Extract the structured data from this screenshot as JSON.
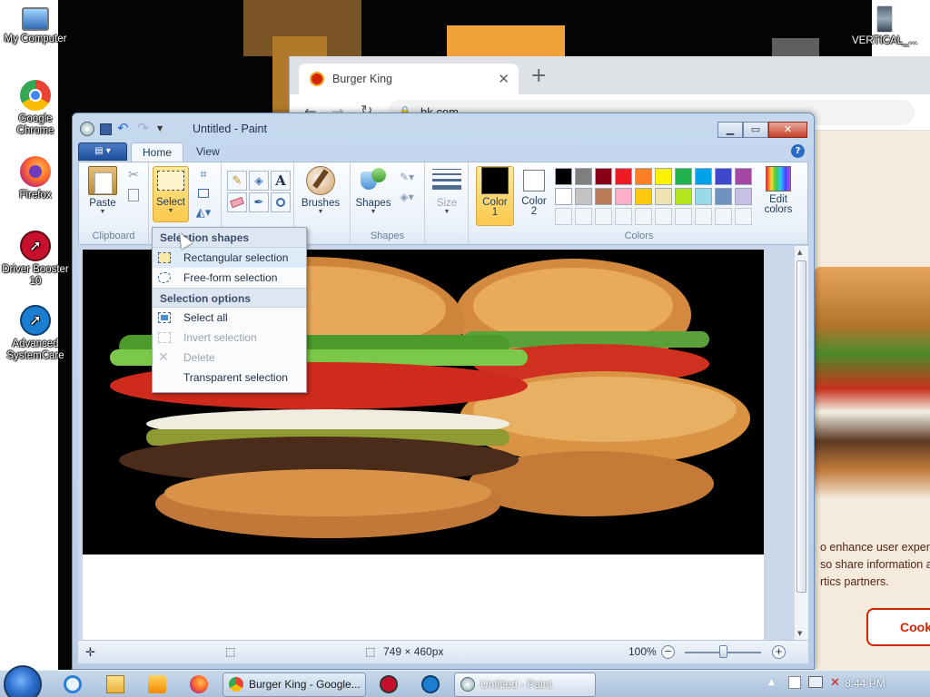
{
  "desktop": {
    "icons": [
      {
        "label_1": "My Computer",
        "label_2": ""
      },
      {
        "label_1": "Google",
        "label_2": "Chrome"
      },
      {
        "label_1": "Firefox",
        "label_2": ""
      },
      {
        "label_1": "Driver Booster",
        "label_2": "10"
      },
      {
        "label_1": "Advanced",
        "label_2": "SystemCare"
      },
      {
        "label_1": "VERTICAL_...",
        "label_2": ""
      }
    ]
  },
  "browser": {
    "tab_title": "Burger King",
    "url": "bk.com",
    "cookie_lines": [
      "o enhance user experie",
      "so share information al",
      "rtics partners."
    ],
    "cookie_button": "Cook"
  },
  "paint": {
    "window_title": "Untitled - Paint",
    "tabs": {
      "home": "Home",
      "view": "View"
    },
    "clipboard": {
      "paste": "Paste",
      "group": "Clipboard"
    },
    "image": {
      "select": "Select"
    },
    "tools_group": {
      "brushes": "Brushes"
    },
    "shapes": {
      "label": "Shapes",
      "group": "Shapes"
    },
    "size": {
      "label": "Size"
    },
    "colors": {
      "color1": "Color",
      "color1_num": "1",
      "color2": "Color",
      "color2_num": "2",
      "edit_1": "Edit",
      "edit_2": "colors",
      "group": "Colors",
      "color1_value": "#000000",
      "color2_value": "#ffffff",
      "palette_row1": [
        "#000000",
        "#7f7f7f",
        "#880015",
        "#ed1c24",
        "#ff7f27",
        "#fff200",
        "#22b14c",
        "#00a2e8",
        "#3f48cc",
        "#a349a4"
      ],
      "palette_row2": [
        "#ffffff",
        "#c3c3c3",
        "#b97a57",
        "#ffaec9",
        "#ffc90e",
        "#efe4b0",
        "#b5e61d",
        "#99d9ea",
        "#7092be",
        "#c8bfe7"
      ]
    },
    "select_menu": {
      "shapes_header": "Selection shapes",
      "rectangular": "Rectangular selection",
      "freeform": "Free-form selection",
      "options_header": "Selection options",
      "select_all": "Select all",
      "invert": "Invert selection",
      "delete": "Delete",
      "transparent": "Transparent selection"
    },
    "status": {
      "dimensions": "749 × 460px",
      "zoom": "100%"
    }
  },
  "taskbar": {
    "chrome_task": "Burger King - Google...",
    "paint_task": "Untitled - Paint",
    "clock": "8:44 PM"
  }
}
